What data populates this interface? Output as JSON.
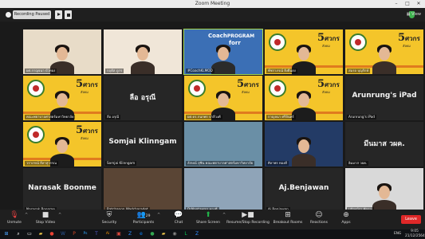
{
  "window": {
    "title": "Zoom Meeting"
  },
  "recording": {
    "status_label": "Recording Paused"
  },
  "view_label": "View",
  "participants": [
    {
      "name": "ผศ.กาญจนา บัวทอง",
      "kind": "person",
      "bg": "#e8dcc8"
    },
    {
      "name": "กฤตัส ภูกร",
      "kind": "person",
      "bg": "#f0e6d8"
    },
    {
      "name": "#CoachKLMOD",
      "kind": "presenter",
      "bg": "#3b6fb5",
      "slide_text_1": "Coach",
      "slide_text_2": "PROGRAM",
      "slide_text_3": "for",
      "slide_text_4": "r"
    },
    {
      "name": "พัชราภรณ์ ยิ่งยืนยง",
      "kind": "poster",
      "bg": "#f4c52a"
    },
    {
      "name": "สมรถ บุญรักษ์",
      "kind": "person",
      "bg": "#f4c52a"
    },
    {
      "name": "คณะพยาบาลศาสตร์มหาวิทยาลัย",
      "kind": "poster",
      "bg": "#f4c52a"
    },
    {
      "name": "ลือ อรุณี",
      "kind": "text",
      "display": "ลือ อรุณี"
    },
    {
      "name": "ผศ.ดร.กนกพร ปาลีวงศ์",
      "kind": "poster",
      "bg": "#f4c52a"
    },
    {
      "name": "กาญจนา ศรีจันทร์",
      "kind": "poster",
      "bg": "#f4c52a"
    },
    {
      "name": "Arunrung's iPad",
      "kind": "text",
      "display": "Arunrung's iPad"
    },
    {
      "name": "วราภรณ์ ลีลาสุวรรณ",
      "kind": "poster",
      "bg": "#f4c52a"
    },
    {
      "name": "Somjai Klinngam",
      "kind": "text",
      "display": "Somjai Klinngam"
    },
    {
      "name": "ลักษณ์ สุชิน คณะพยาบาลศาสตร์มหาวิทยาลัย",
      "kind": "photo",
      "bg": "#6a8fa6"
    },
    {
      "name": "ศิลาพร ทองดี",
      "kind": "portrait",
      "bg": "#233b66"
    },
    {
      "name": "อิมมาส วผค.",
      "kind": "text",
      "display": "มีนมาส วผค."
    },
    {
      "name": "Narasak Boonme",
      "kind": "text",
      "display": "Narasak Boonme"
    },
    {
      "name": "Ratchanon Wadcharadet",
      "kind": "photo",
      "bg": "#5a4535"
    },
    {
      "name": "DrNantawan ทองดี",
      "kind": "photo",
      "bg": "#8fa4b8"
    },
    {
      "name": "Aj.Benjawan",
      "kind": "text",
      "display": "Aj.Benjawan"
    },
    {
      "name": "ปฏิญญ์รา พัฒนะ",
      "kind": "portrait",
      "bg": "#d9d9d9"
    }
  ],
  "poster": {
    "number": "5",
    "title": "ศวกร",
    "subtitle": "สังคม"
  },
  "toolbar": {
    "unmute": "Unmute",
    "stop_video": "Stop Video",
    "security": "Security",
    "participants": "Participants",
    "participant_count": "29",
    "chat": "Chat",
    "share_screen": "Share Screen",
    "recording": "Resume/Stop Recording",
    "breakout": "Breakout Rooms",
    "reactions": "Reactions",
    "apps": "Apps",
    "leave": "Leave"
  },
  "taskbar": {
    "apps": [
      "search-icon",
      "taskview-icon",
      "explorer-icon",
      "chrome-icon",
      "word-icon",
      "powerpoint-icon",
      "photoshop-icon",
      "teams-icon",
      "illustrator-icon",
      "app-icon",
      "zoom-icon",
      "edge-icon",
      "chrome2-icon",
      "files-icon",
      "camera-icon",
      "line-icon",
      "zoom2-icon"
    ],
    "language": "ENG",
    "time": "9:05",
    "date": "21/12/2564"
  },
  "colors": {
    "accent": "#a5d64a",
    "leave": "#e02828",
    "share": "#21b64a",
    "poster_yellow": "#f4c52a"
  }
}
